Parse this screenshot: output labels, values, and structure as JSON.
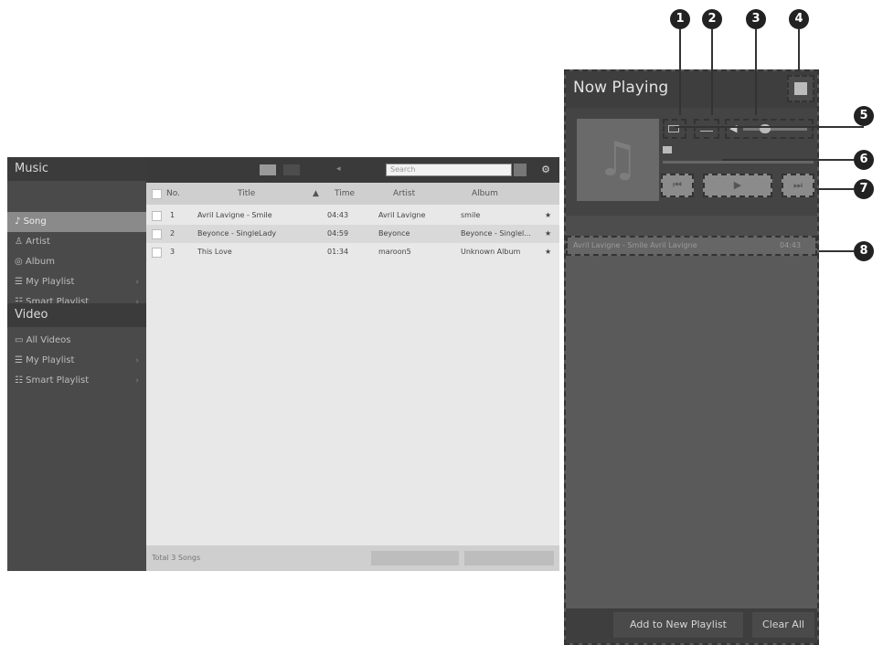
{
  "sidebar": {
    "music_header": "Music",
    "music_items": [
      {
        "label": "Song",
        "active": true
      },
      {
        "label": "Artist",
        "active": false
      },
      {
        "label": "Album",
        "active": false
      },
      {
        "label": "My Playlist",
        "active": false
      },
      {
        "label": "Smart Playlist",
        "active": false
      }
    ],
    "video_header": "Video",
    "video_items": [
      {
        "label": "All Videos"
      },
      {
        "label": "My Playlist"
      },
      {
        "label": "Smart Playlist"
      }
    ]
  },
  "toolbar": {
    "search_placeholder": "Search"
  },
  "table": {
    "columns": [
      "No.",
      "Title",
      "Time",
      "Artist",
      "Album"
    ],
    "rows": [
      {
        "no": "1",
        "title": "Avril Lavigne - Smile",
        "time": "04:43",
        "artist": "Avril Lavigne",
        "album": "smile"
      },
      {
        "no": "2",
        "title": "Beyonce - SingleLady",
        "time": "04:59",
        "artist": "Beyonce",
        "album": "Beyonce - Singlel..."
      },
      {
        "no": "3",
        "title": "This Love",
        "time": "01:34",
        "artist": "maroon5",
        "album": "Unknown Album"
      }
    ],
    "footer_count": "Total 3 Songs"
  },
  "now_playing": {
    "title": "Now Playing",
    "add_to_playlist_label": "Add to New Playlist",
    "clear_all_label": "Clear All",
    "track_row_text": "Avril Lavigne - Smile  Avril Lavigne",
    "track_row_time": "04:43"
  },
  "callouts": [
    "1",
    "2",
    "3",
    "4",
    "5",
    "6",
    "7",
    "8"
  ],
  "colors": {
    "sidebar_bg": "#4a4a4a",
    "active_item": "#8a8a8a",
    "list_bg": "#e8e8e8",
    "now_playing_bg": "#5a5a5a"
  }
}
